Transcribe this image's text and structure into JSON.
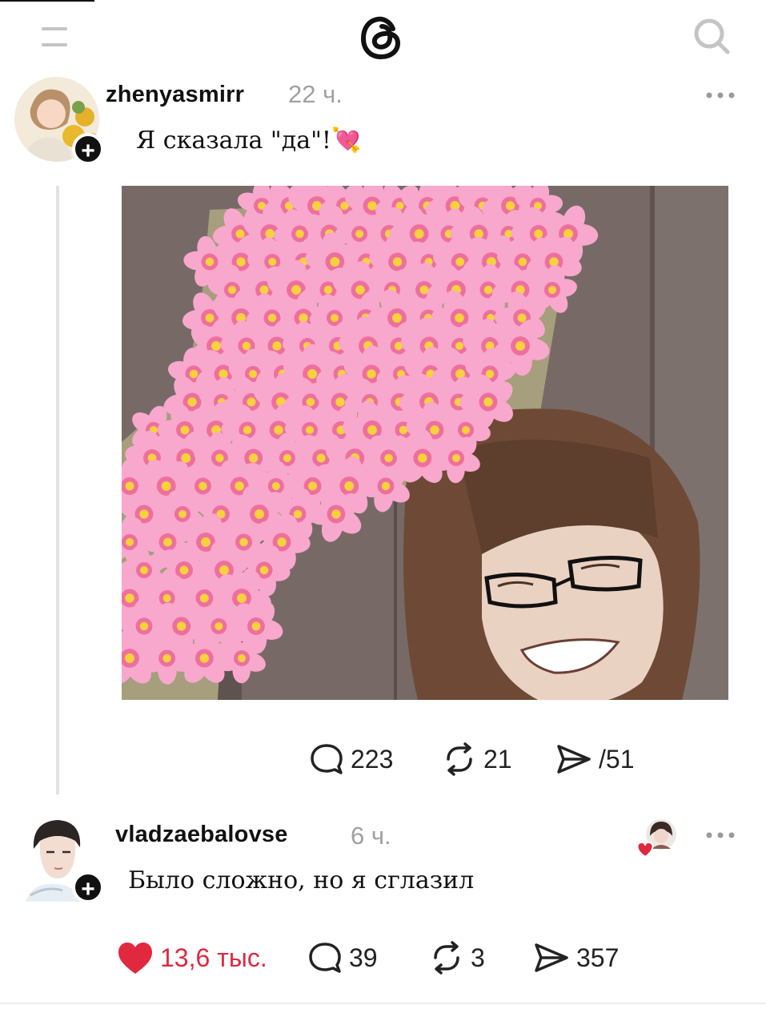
{
  "header": {
    "menu_icon": "menu-icon",
    "logo_icon": "threads-logo-icon",
    "search_icon": "search-icon"
  },
  "post": {
    "username": "zhenyasmirr",
    "time": "22 ч.",
    "text": "Я сказала \"да\"!💘",
    "actions": {
      "replies": "223",
      "reposts": "21",
      "shares": "/51"
    }
  },
  "reply": {
    "username": "vladzaebalovse",
    "time": "6 ч.",
    "text": "Было сложно, но я сглазил",
    "actions": {
      "likes": "13,6 тыс.",
      "replies": "39",
      "reposts": "3",
      "shares": "357"
    }
  },
  "colors": {
    "like_red": "#e0283f",
    "blossom_pink": "#f7a3c8"
  }
}
